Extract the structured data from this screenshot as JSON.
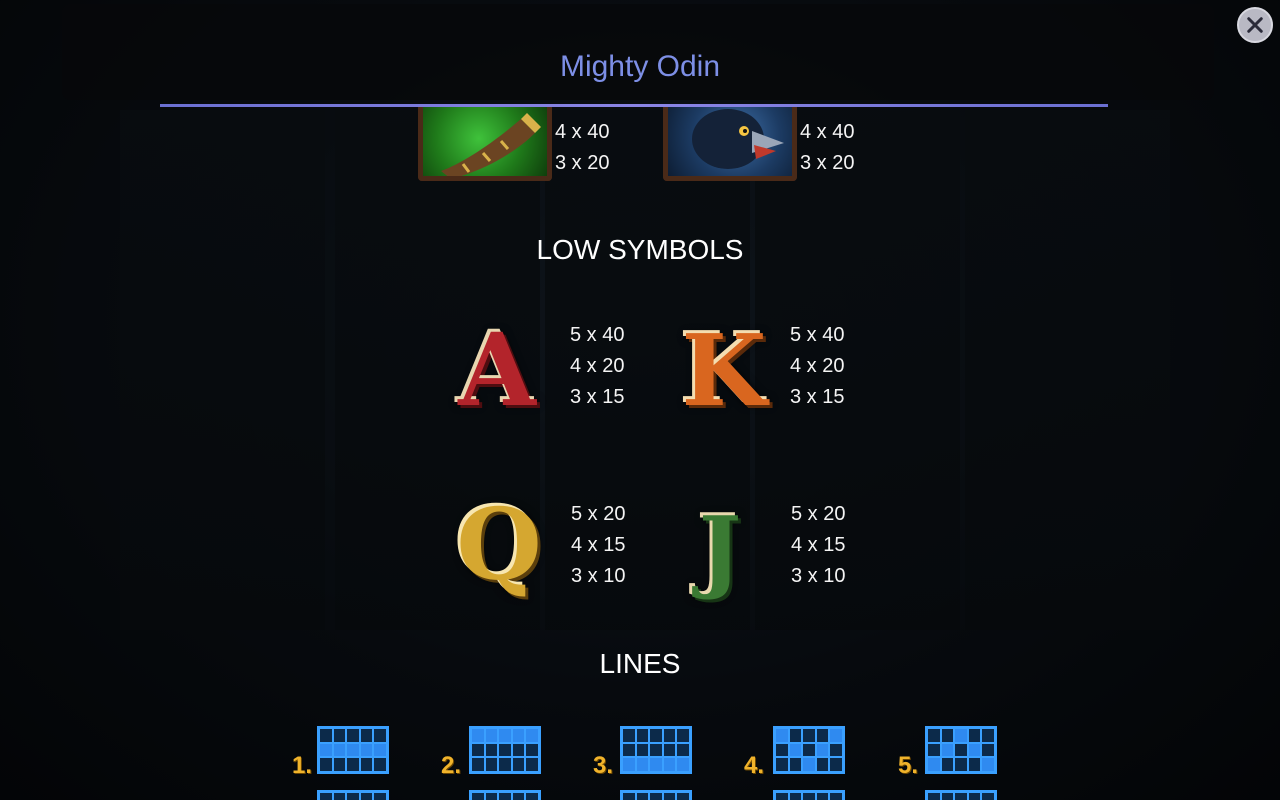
{
  "header": {
    "title": "Mighty Odin"
  },
  "controls": {
    "close_icon": "close-icon"
  },
  "top_symbols": [
    {
      "icon": "horn-symbol-icon",
      "pays": [
        "4 x 40",
        "3 x 20"
      ]
    },
    {
      "icon": "raven-symbol-icon",
      "pays": [
        "4 x 40",
        "3 x 20"
      ]
    }
  ],
  "low_symbols": {
    "title": "LOW SYMBOLS",
    "items": [
      {
        "symbol": "A",
        "pays": [
          "5 x 40",
          "4 x 20",
          "3 x 15"
        ],
        "color": "#b3242b"
      },
      {
        "symbol": "K",
        "pays": [
          "5 x 40",
          "4 x 20",
          "3 x 15"
        ],
        "color": "#d9661f"
      },
      {
        "symbol": "Q",
        "pays": [
          "5 x 20",
          "4 x 15",
          "3 x 10"
        ],
        "color": "#d5a730"
      },
      {
        "symbol": "J",
        "pays": [
          "5 x 20",
          "4 x 15",
          "3 x 10"
        ],
        "color": "#3a7a33"
      }
    ]
  },
  "lines": {
    "title": "LINES",
    "items": [
      {
        "label": "1.",
        "row_pattern": [
          1,
          1,
          1,
          1,
          1
        ]
      },
      {
        "label": "2.",
        "row_pattern": [
          0,
          0,
          0,
          0,
          0
        ]
      },
      {
        "label": "3.",
        "row_pattern": [
          2,
          2,
          2,
          2,
          2
        ]
      },
      {
        "label": "4.",
        "row_pattern": [
          0,
          1,
          2,
          1,
          0
        ]
      },
      {
        "label": "5.",
        "row_pattern": [
          2,
          1,
          0,
          1,
          2
        ]
      }
    ]
  },
  "colors": {
    "title": "#7d8fe6",
    "divider": "#7b7fe0",
    "line_number": "#f0b32b",
    "line_grid": "#3aa0ff"
  }
}
